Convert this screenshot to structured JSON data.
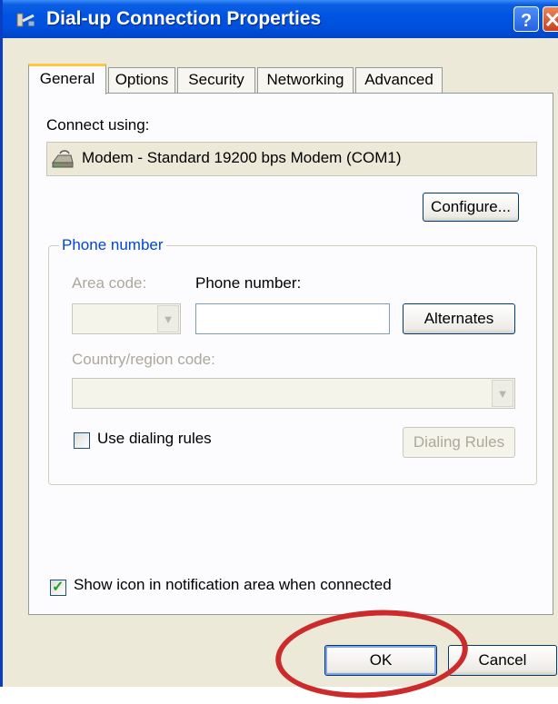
{
  "window": {
    "title": "Dial-up Connection Properties"
  },
  "tabs": [
    {
      "label": "General",
      "active": true
    },
    {
      "label": "Options",
      "active": false
    },
    {
      "label": "Security",
      "active": false
    },
    {
      "label": "Networking",
      "active": false
    },
    {
      "label": "Advanced",
      "active": false
    }
  ],
  "general": {
    "connect_using_label": "Connect using:",
    "modem_name": "Modem - Standard 19200 bps Modem (COM1)",
    "configure_label": "Configure...",
    "phone_group": {
      "title": "Phone number",
      "area_code_label": "Area code:",
      "area_code_value": "",
      "phone_number_label": "Phone number:",
      "phone_number_value": "",
      "alternates_label": "Alternates",
      "country_label": "Country/region code:",
      "country_value": "",
      "use_dialing_rules_label": "Use dialing rules",
      "use_dialing_rules_checked": false,
      "dialing_rules_label": "Dialing Rules"
    },
    "show_icon_label": "Show icon in notification area when connected",
    "show_icon_checked": true
  },
  "footer": {
    "ok_label": "OK",
    "cancel_label": "Cancel"
  },
  "annotation": {
    "color": "#cc2b2b",
    "target": "ok-button"
  },
  "colors": {
    "titlebar": "#0054e3",
    "window_bg": "#ece9d8",
    "panel_bg": "#fcfcfe",
    "group_title": "#0046d5",
    "disabled_text": "#aca899",
    "active_tab_accent": "#ffc83c"
  }
}
